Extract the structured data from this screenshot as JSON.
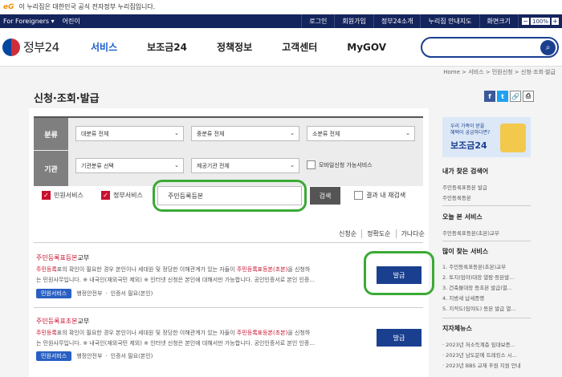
{
  "topbar": {
    "logo": "eG",
    "notice": "이 누리집은 대한민국 공식 전자정부 누리집입니다."
  },
  "utilbar": {
    "foreigners": "For Foreigners ▾",
    "kids": "어린이",
    "links": [
      "로그인",
      "회원가입",
      "정부24소개",
      "누리집 안내지도",
      "화면크기"
    ],
    "zoom_minus": "−",
    "zoom_value": "100%",
    "zoom_plus": "+"
  },
  "header": {
    "logo": "정부24",
    "nav": [
      "서비스",
      "보조금24",
      "정책정보",
      "고객센터",
      "MyGOV"
    ],
    "search_icon": "search-icon"
  },
  "breadcrumb": "Home  >  서비스  >  민원신청  >  신청·조회·발급",
  "page_title": "신청·조회·발급",
  "share": [
    "f",
    "t",
    "🔗",
    "⎙"
  ],
  "filter": {
    "label_category": "분류",
    "label_org": "기관",
    "cat_large": "대분류 전체",
    "cat_mid": "중분류 전체",
    "cat_small": "소분류 전체",
    "org_type": "기관분류 선택",
    "org_provider": "제공기관 전체",
    "mobile_only": "모바일신청 가능서비스",
    "chk_minwon": "민원서비스",
    "chk_gov": "정부서비스",
    "keyword": "주민등록등본",
    "search_btn": "검색",
    "in_results": "결과 내 재검색"
  },
  "sort": [
    "신청순",
    "정확도순",
    "가나다순"
  ],
  "results": [
    {
      "title_hl": "주민등록표등본",
      "title_rest": "교부",
      "desc_a": "주민등록",
      "desc_b": "표의 확인이 필요한 경우 본인이나 세대원 및 정당한 이해관계가 있는 자들이 ",
      "desc_c": "주민등록표등본(초본)",
      "desc_d": "을 신청하",
      "desc_line2": "는 민원사무입니다. ※ 내국인(재외국민 제외) ※ 인터넷 신청은 본인에 대해서만 가능합니다. 공인인증서로 본인 인증...",
      "tag": "민원서비스",
      "org": "행정안전부",
      "auth": "인증서 필요(본인)",
      "button": "발급"
    },
    {
      "title_hl": "주민등록표초본",
      "title_rest": "교부",
      "desc_a": "주민등록",
      "desc_b": "표의 확인이 필요한 경우 본인이나 세대원 및 정당한 이해관계가 있는 자들이 ",
      "desc_c": "주민등록표등본(초본)",
      "desc_d": "을 신청하",
      "desc_line2": "는 민원사무입니다. ※ 내국인(재외국민 제외) ※ 인터넷 신청은 본인에 대해서만 가능합니다. 공인인증서로 본인 인증...",
      "tag": "민원서비스",
      "org": "행정안전부",
      "auth": "인증서 필요(본인)",
      "button": "발급"
    }
  ],
  "side": {
    "banner_line1": "우리 가족이 받을",
    "banner_line2": "혜택이 궁금하다면?",
    "banner_title": "보조금24",
    "my_search_title": "내가 찾은 검색어",
    "my_search": [
      "주민등록표등본 발급",
      "주민등록등본"
    ],
    "today_title": "오늘 본 서비스",
    "today": [
      "주민등록표등본(초본)교부"
    ],
    "popular_title": "많이 찾는 서비스",
    "popular": [
      "1. 주민등록표등본(초본)교부",
      "2. 토지(임야)대장 열람·등본발...",
      "3. 건축물대장 등초본 발급(열...",
      "4. 지방세 납세증명",
      "5. 지적도(임야도) 등본 발급 열..."
    ],
    "news_title": "지자체뉴스",
    "news": [
      "· 2023년 저소득계층 임대보증...",
      "· 2023년 남도문에 트레킹스 시...",
      "· 2023년 BBS 교재 후원 지원 안내"
    ]
  }
}
